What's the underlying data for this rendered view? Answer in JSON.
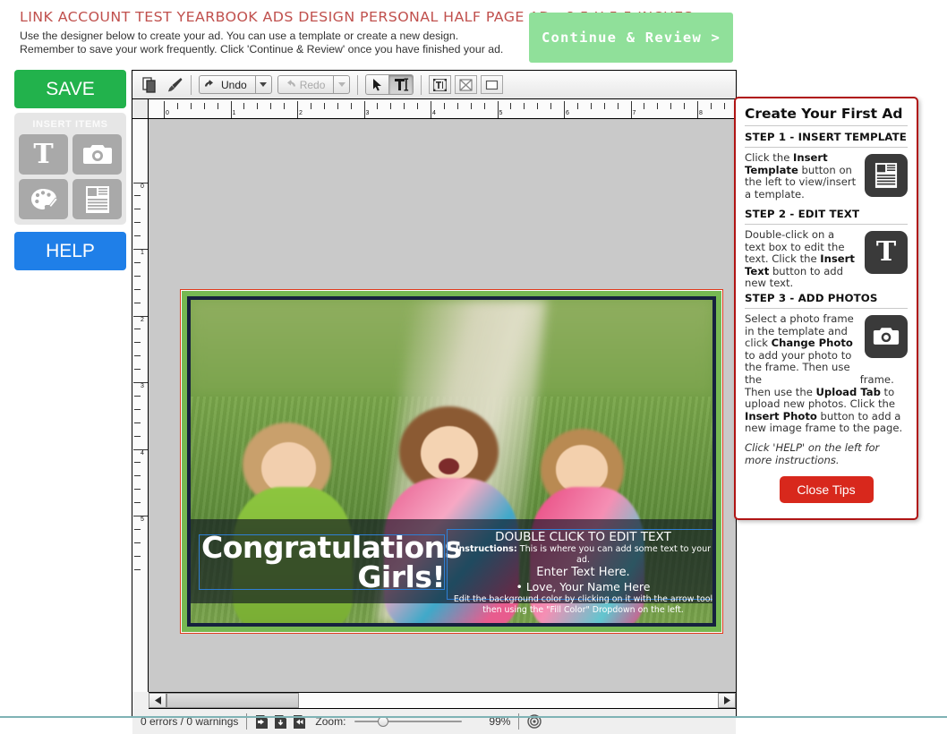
{
  "header": {
    "title": "LINK ACCOUNT TEST YEARBOOK ADS DESIGN PERSONAL HALF PAGE AD - 8.5 X 5.5 INCHES",
    "sub_line1": "Use the designer below to create your ad. You can use a template or create a new design.",
    "sub_line2": "Remember to save your work frequently. Click 'Continue & Review' once you have finished your ad.",
    "continue_label": "Continue & Review >",
    "continue_color": "#90e09a"
  },
  "sidebar": {
    "save_label": "SAVE",
    "save_color": "#22b24c",
    "insert_title": "INSERT ITEMS",
    "insert_items": [
      {
        "label": "Insert Text",
        "icon": "text-T-icon"
      },
      {
        "label": "Insert Photo",
        "icon": "camera-icon"
      },
      {
        "label": "Insert Art",
        "icon": "palette-icon"
      },
      {
        "label": "Insert Template",
        "icon": "template-icon"
      }
    ],
    "help_label": "HELP",
    "help_color": "#1f7fe8"
  },
  "toolbar": {
    "copy_icon": "copy-pages-icon",
    "format_painter_icon": "paintbrush-icon",
    "undo_label": "Undo",
    "redo_label": "Redo",
    "redo_disabled": true,
    "tools": [
      {
        "name": "arrow-tool",
        "active": false
      },
      {
        "name": "text-tool",
        "active": true
      }
    ],
    "inserts": [
      {
        "name": "insert-text-frame"
      },
      {
        "name": "insert-image-frame"
      },
      {
        "name": "insert-shape-frame"
      }
    ]
  },
  "rulers": {
    "horizontal_labels": [
      "0",
      "1",
      "2",
      "3",
      "4",
      "5",
      "6",
      "7",
      "8"
    ],
    "vertical_labels": [
      "0",
      "1",
      "2",
      "3",
      "4",
      "5"
    ],
    "unit": "inches"
  },
  "canvas": {
    "bleed_color": "#e03a1c",
    "border_color": "#76b852",
    "frame_color": "#16213e",
    "selection_color": "#2f7fd4",
    "text_left_line1": "Congratulations",
    "text_left_line2": "Girls!",
    "text_right_line1": "DOUBLE CLICK TO EDIT TEXT",
    "text_right_line2_label": "Instructions:",
    "text_right_line2": " This is where you can add some text to your ad.",
    "text_right_line3": "Enter Text Here.",
    "text_right_line4": "• Love, Your Name Here",
    "text_right_line5a": "Edit the background color by clicking on it with the arrow tool",
    "text_right_line5b": "then using the \"Fill Color\" Dropdown on the left."
  },
  "status": {
    "errors_warnings": "0 errors / 0 warnings",
    "zoom_label": "Zoom:",
    "zoom_value": "99%",
    "page_icons": [
      "page-prev-icon",
      "page-save-icon",
      "page-next-icon"
    ],
    "fit_icon": "fit-target-icon"
  },
  "tips": {
    "title": "Create Your First Ad",
    "steps": [
      {
        "heading": "STEP 1 - INSERT TEMPLATE",
        "body_pre": "Click the ",
        "body_b1": "Insert Template",
        "body_post": " button on the left to view/insert a template.",
        "icon": "template-icon"
      },
      {
        "heading": "STEP 2 - EDIT TEXT",
        "body_pre": "Double-click on a text box to edit the text. Click the ",
        "body_b1": "Insert Text",
        "body_post": " button to add new text.",
        "icon": "text-T-icon"
      },
      {
        "heading": "STEP 3 - ADD PHOTOS",
        "body_pre": "Select a photo frame in the template and click ",
        "body_b1": "Change Photo",
        "body_mid": " to add your photo to the frame. Then use the ",
        "body_b2": "Upload Tab",
        "body_mid2": " to upload new photos. Click the ",
        "body_b3": "Insert Photo",
        "body_post": " button to add a new image frame to the page.",
        "icon": "camera-icon"
      }
    ],
    "note": "Click 'HELP' on the left for more instructions.",
    "close_label": "Close Tips",
    "close_color": "#d8281c"
  }
}
